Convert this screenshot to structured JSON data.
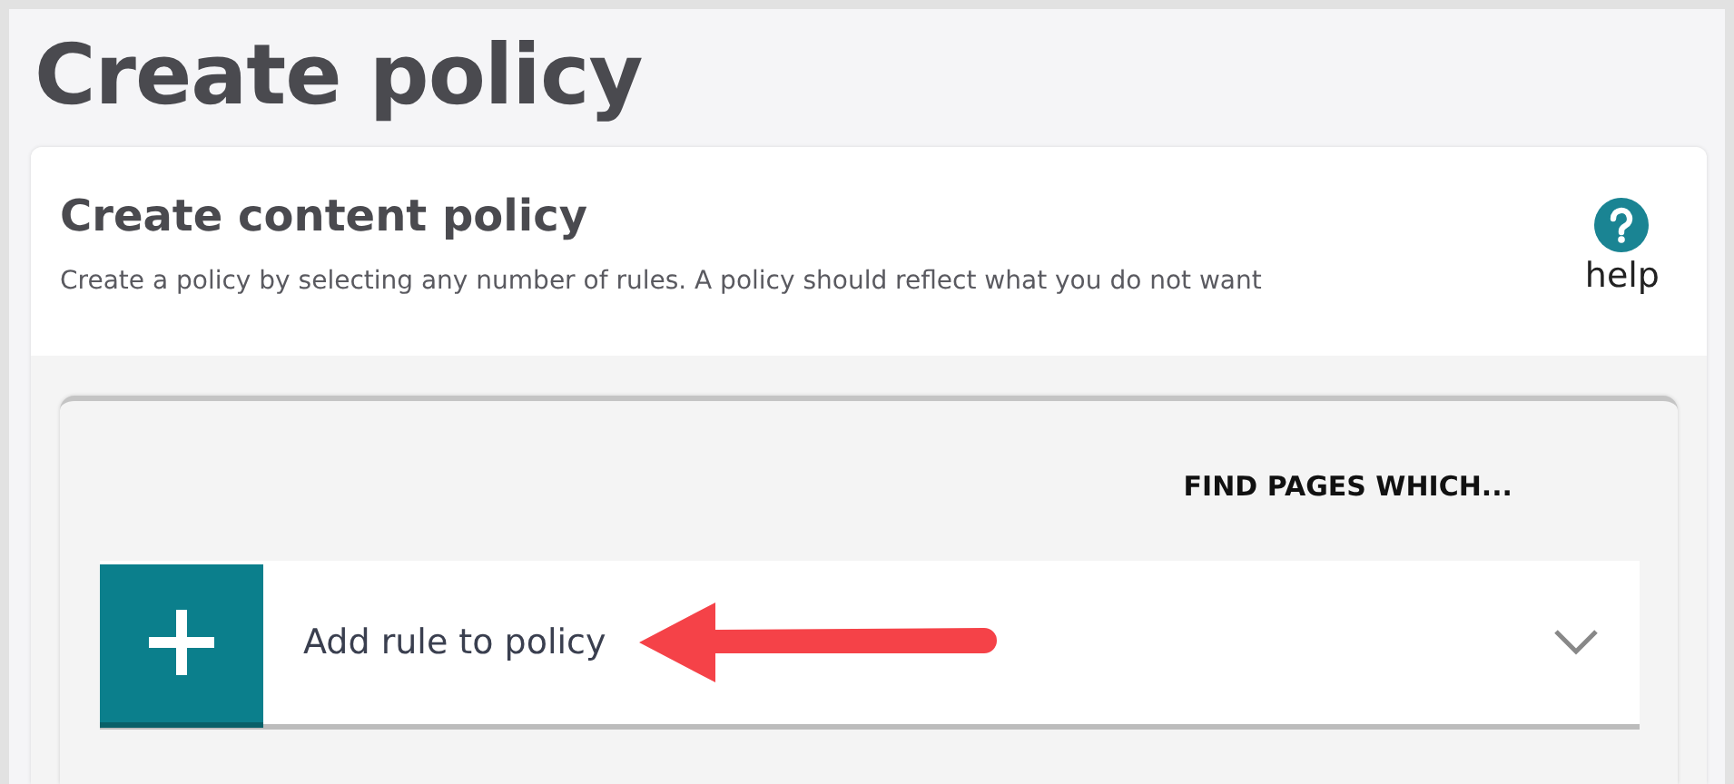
{
  "page_title": "Create policy",
  "card": {
    "title": "Create content policy",
    "description": "Create a policy by selecting any number of rules. A policy should reflect what you do not want",
    "help": {
      "label": "help"
    }
  },
  "rules_panel": {
    "heading": "FIND PAGES WHICH...",
    "add_rule": {
      "label": "Add rule to policy",
      "expanded": false
    }
  }
}
